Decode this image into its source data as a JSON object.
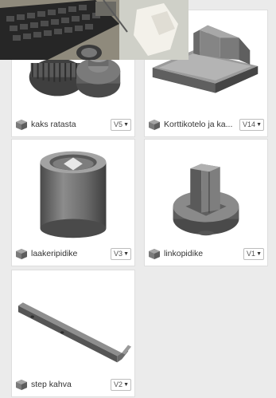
{
  "designs": [
    {
      "name": "kaks ratasta",
      "version": "V5"
    },
    {
      "name": "Korttikotelo ja ka...",
      "version": "V14"
    },
    {
      "name": "laakeripidike",
      "version": "V3"
    },
    {
      "name": "linkopidike",
      "version": "V1"
    },
    {
      "name": "step kahva",
      "version": "V2"
    }
  ],
  "icons": {
    "design_file": "design-file-icon",
    "version_caret": "chevron-down-icon"
  },
  "colors": {
    "page_background": "#ebebeb",
    "card_background": "#ffffff",
    "model_gray": "#6f6f6f"
  }
}
